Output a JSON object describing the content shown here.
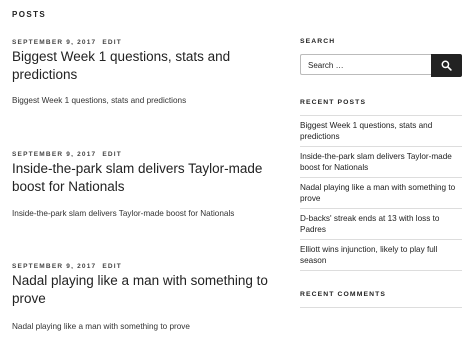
{
  "page": {
    "title": "POSTS"
  },
  "posts": [
    {
      "date": "SEPTEMBER 9, 2017",
      "edit": "EDIT",
      "title": "Biggest Week 1 questions, stats and predictions",
      "excerpt": "Biggest Week 1 questions, stats and predictions"
    },
    {
      "date": "SEPTEMBER 9, 2017",
      "edit": "EDIT",
      "title": "Inside-the-park slam delivers Taylor-made boost for Nationals",
      "excerpt": "Inside-the-park slam delivers Taylor-made boost for Nationals"
    },
    {
      "date": "SEPTEMBER 9, 2017",
      "edit": "EDIT",
      "title": "Nadal playing like a man with something to prove",
      "excerpt": "Nadal playing like a man with something to prove"
    }
  ],
  "sidebar": {
    "search": {
      "title": "SEARCH",
      "placeholder": "Search …",
      "button_icon": "search-icon"
    },
    "recent_posts": {
      "title": "RECENT POSTS",
      "items": [
        "Biggest Week 1 questions, stats and predictions",
        "Inside-the-park slam delivers Taylor-made boost for Nationals",
        "Nadal playing like a man with something to prove",
        "D-backs' streak ends at 13 with loss to Padres",
        "Elliott wins injunction, likely to play full season"
      ]
    },
    "recent_comments": {
      "title": "RECENT COMMENTS"
    }
  },
  "colors": {
    "text": "#222222",
    "button_bg": "#222222",
    "divider": "#dddddd"
  }
}
